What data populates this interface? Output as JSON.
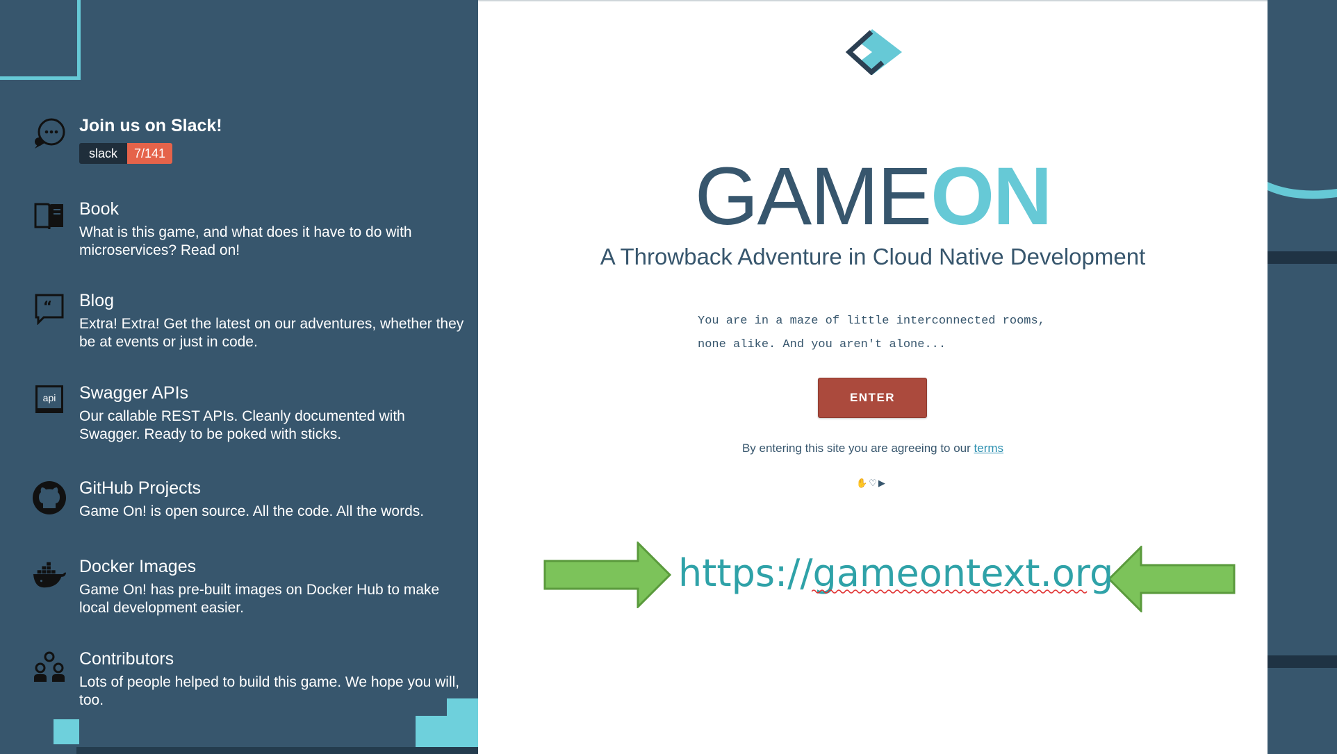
{
  "sidebar": {
    "items": [
      {
        "title": "Join us on Slack!",
        "badge_left": "slack",
        "badge_right": "7/141",
        "icon": "chat-bubble-icon"
      },
      {
        "title": "Book",
        "desc": "What is this game, and what does it have to do with microservices? Read on!",
        "icon": "book-icon"
      },
      {
        "title": "Blog",
        "desc": "Extra! Extra! Get the latest on our adventures, whether they be at events or just in code.",
        "icon": "quote-icon"
      },
      {
        "title": "Swagger APIs",
        "desc": "Our callable REST APIs. Cleanly documented with Swagger. Ready to be poked with sticks.",
        "icon": "api-icon",
        "icon_text": "api"
      },
      {
        "title": "GitHub Projects",
        "desc": "Game On! is open source. All the code. All the words.",
        "icon": "github-icon"
      },
      {
        "title": "Docker Images",
        "desc": "Game On! has pre-built images on Docker Hub to make local development easier.",
        "icon": "docker-icon"
      },
      {
        "title": "Contributors",
        "desc": "Lots of people helped to build this game. We hope you will, too.",
        "icon": "people-icon"
      }
    ]
  },
  "main": {
    "title_a": "GAME",
    "title_b": "ON",
    "subtitle": "A Throwback Adventure in Cloud Native Development",
    "intro_line1": "You are in a maze of little interconnected rooms,",
    "intro_line2": "none alike. And you aren't alone...",
    "enter_label": "ENTER",
    "terms_prefix": "By entering this site you are agreeing to our",
    "terms_link": "terms",
    "tiny_icons": [
      "✋",
      "♡",
      "▶"
    ],
    "url": "https://gameontext.org"
  },
  "colors": {
    "sidebar_bg": "#37566d",
    "accent": "#66c9d6",
    "enter_btn": "#ab4a3d",
    "badge_count": "#e5634a",
    "arrow_fill": "#7cc35a",
    "url_text": "#2fa2a8"
  }
}
